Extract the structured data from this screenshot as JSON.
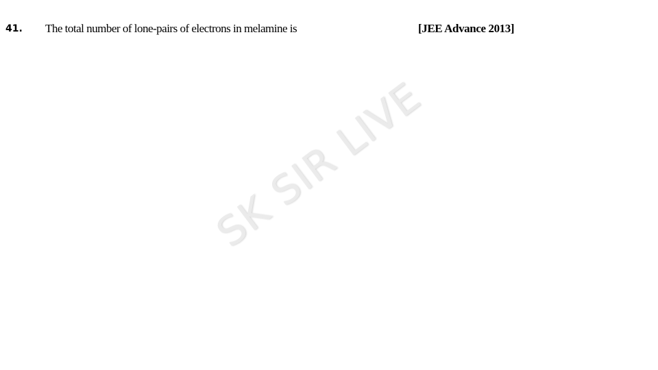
{
  "question": {
    "number": "41.",
    "text": "The total number of lone-pairs of electrons in melamine is",
    "source": "[JEE Advance 2013]"
  },
  "watermark": {
    "text": "SK SIR LIVE",
    "color": "#ebebeb"
  }
}
